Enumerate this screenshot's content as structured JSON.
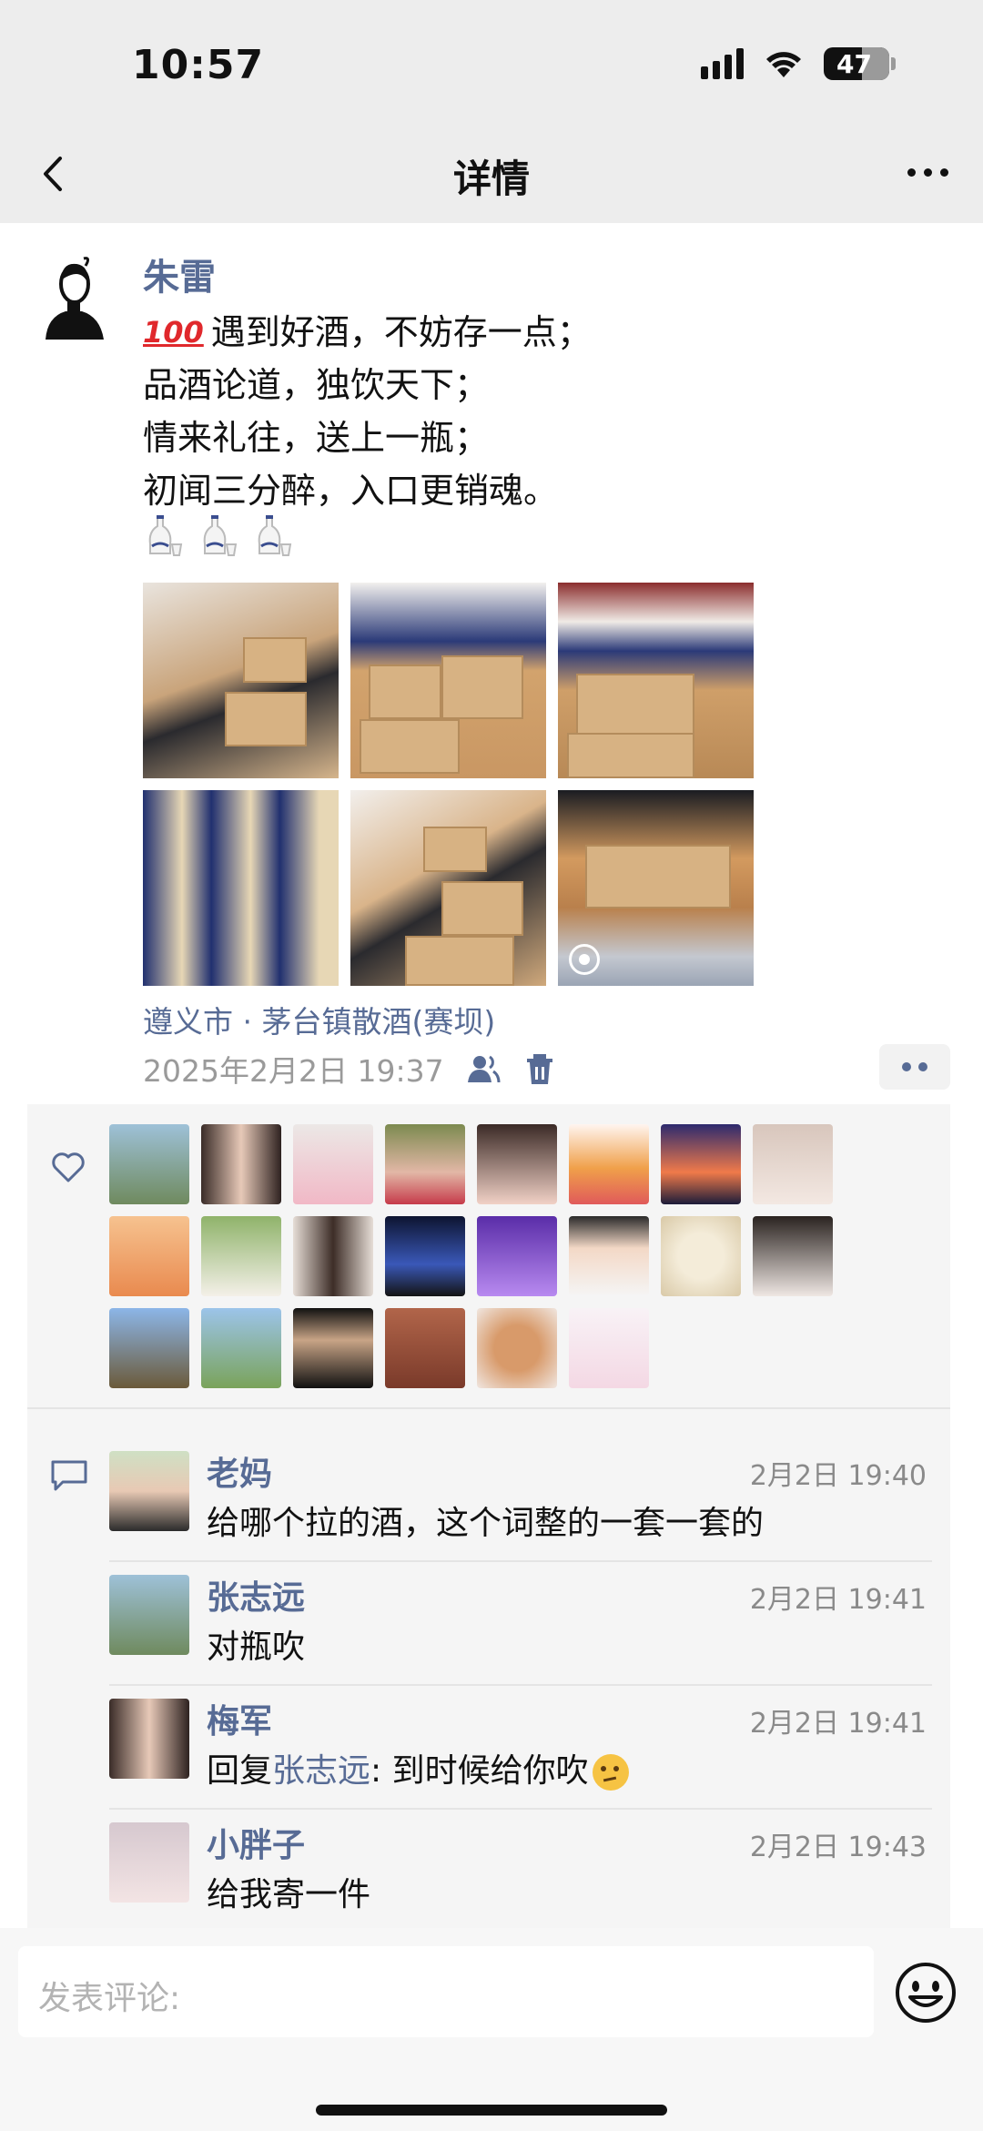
{
  "status_bar": {
    "time": "10:57",
    "battery": "47"
  },
  "nav": {
    "title": "详情"
  },
  "post": {
    "author": "朱雷",
    "lines": [
      "遇到好酒，不妨存一点；",
      "品酒论道，独饮天下；",
      "情来礼往，送上一瓶；",
      "初闻三分醉，入口更销魂。"
    ],
    "leading_emoji": "100",
    "location": "遵义市 · 茅台镇散酒(赛坝)",
    "time": "2025年2月2日 19:37",
    "photo_count": 6
  },
  "likes": {
    "count": 22
  },
  "comments": [
    {
      "name": "老妈",
      "time": "2月2日 19:40",
      "text": "给哪个拉的酒，这个词整的一套一套的"
    },
    {
      "name": "张志远",
      "time": "2月2日 19:41",
      "text": "对瓶吹"
    },
    {
      "name": "梅军",
      "time": "2月2日 19:41",
      "reply_prefix": "回复",
      "reply_to": "张志远",
      "text": ": 到时候给你吹"
    },
    {
      "name": "小胖子",
      "time": "2月2日 19:43",
      "text": "给我寄一件"
    }
  ],
  "input": {
    "placeholder": "发表评论:"
  },
  "colors": {
    "link": "#576b95",
    "background": "#ededed",
    "panel": "#f5f5f5"
  }
}
